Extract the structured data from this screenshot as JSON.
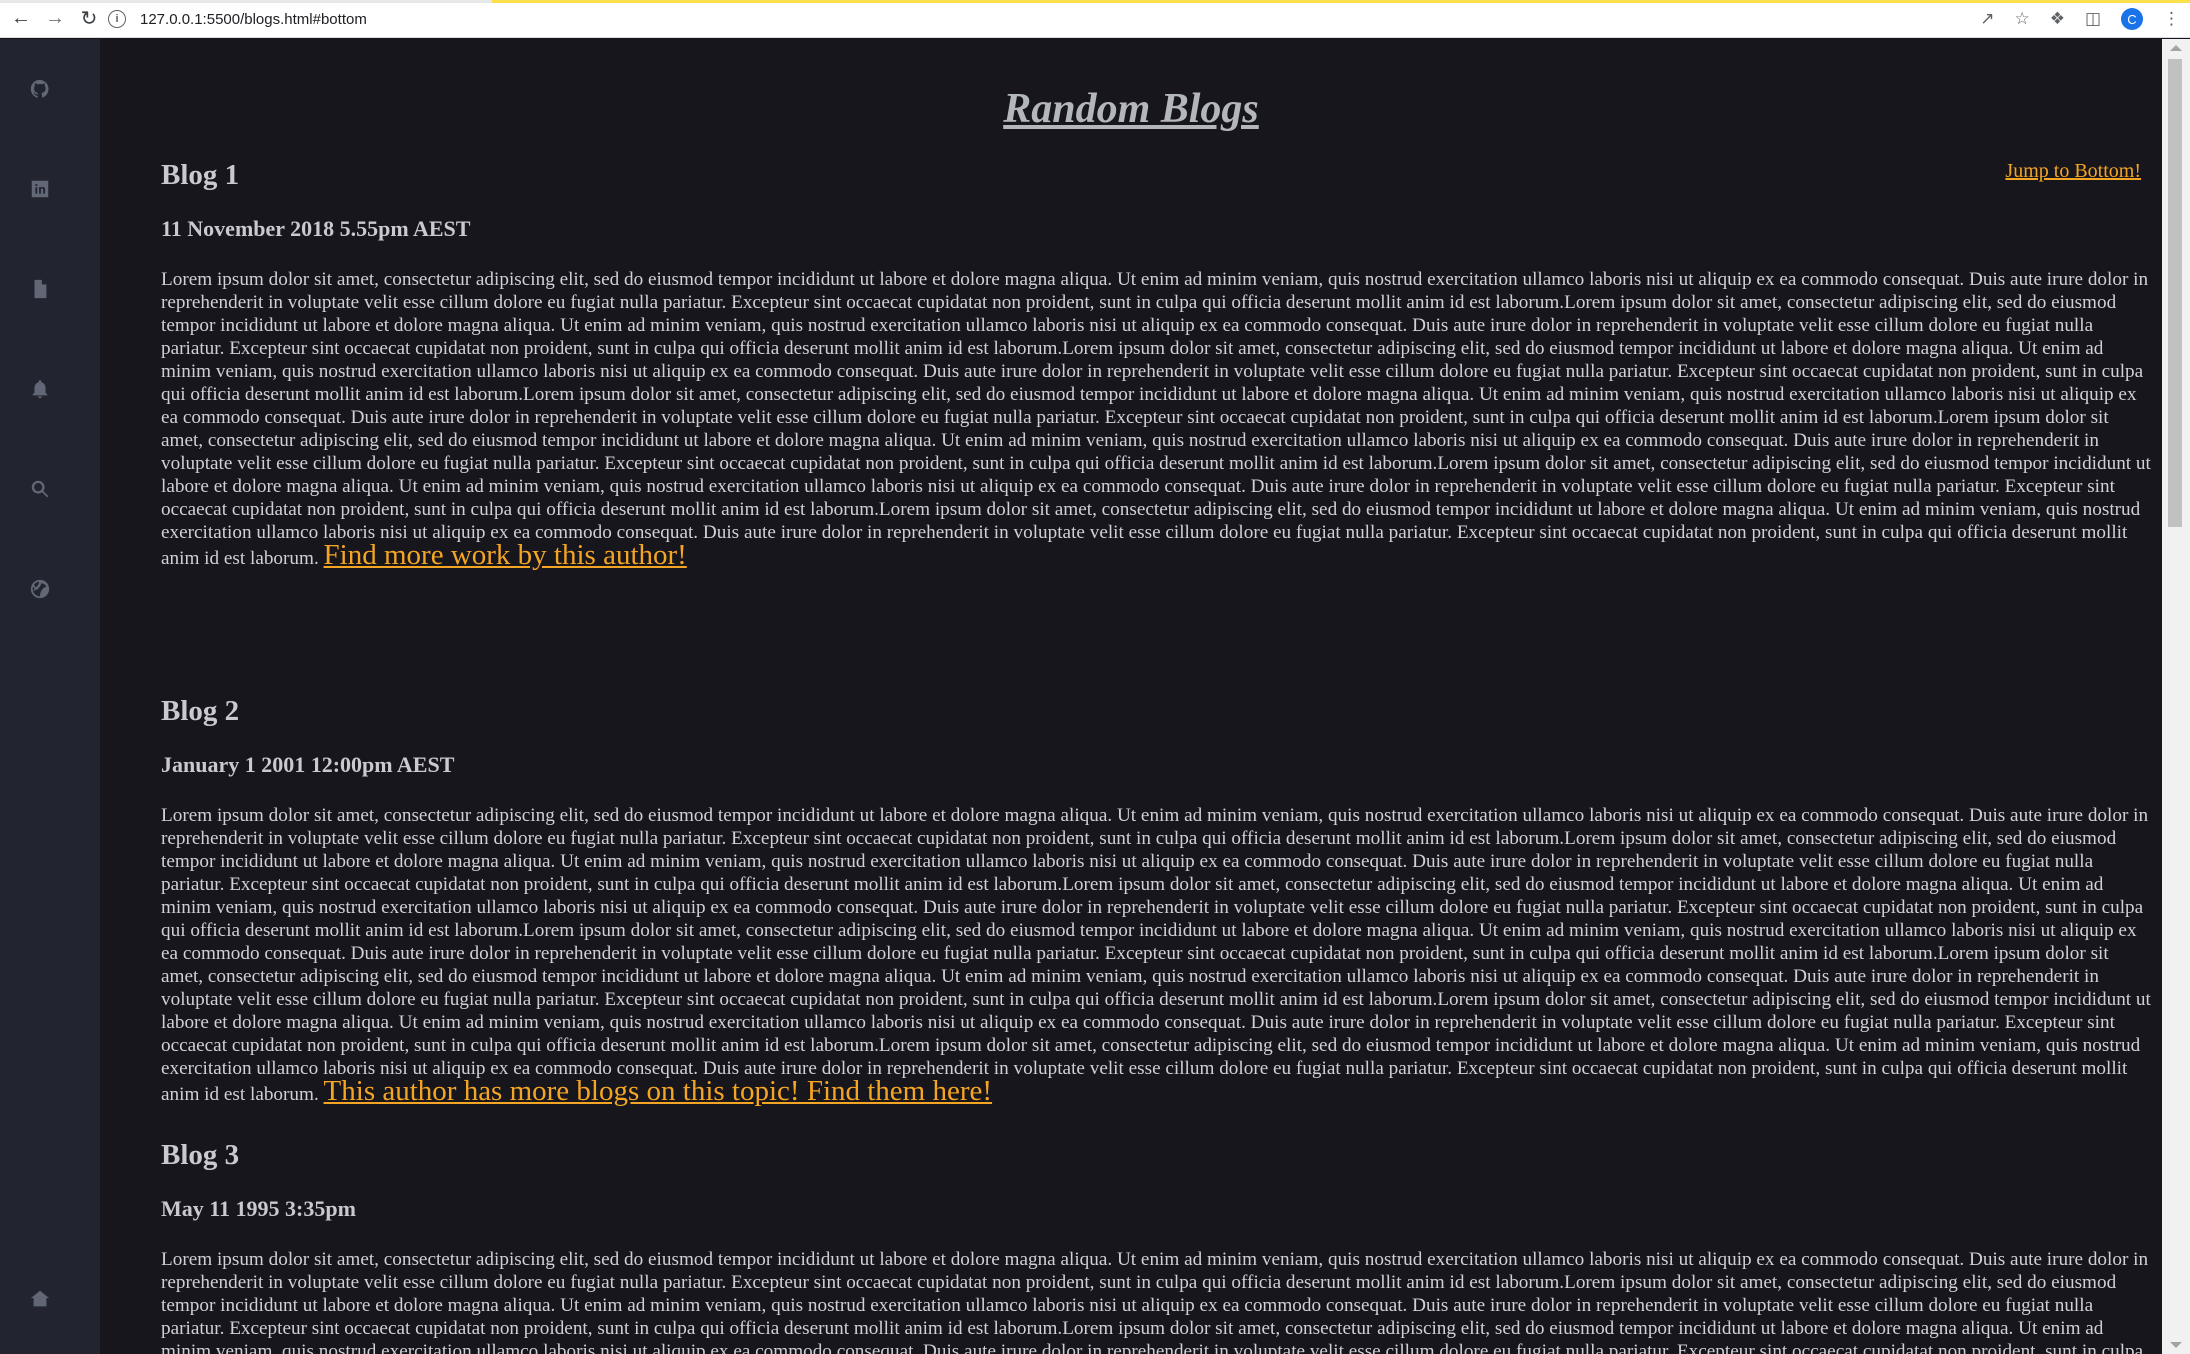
{
  "browser": {
    "url": "127.0.0.1:5500/blogs.html#bottom",
    "avatar_letter": "C"
  },
  "sidebar": {
    "items": [
      {
        "icon": "github-icon"
      },
      {
        "icon": "linkedin-icon"
      },
      {
        "icon": "document-icon"
      },
      {
        "icon": "bell-icon"
      },
      {
        "icon": "search-icon"
      },
      {
        "icon": "basketball-icon"
      },
      {
        "icon": "home-icon"
      }
    ]
  },
  "page": {
    "title": "Random Blogs",
    "jump_link": "Jump to Bottom!"
  },
  "blogs": [
    {
      "title": "Blog 1",
      "date": "11 November 2018 5.55pm AEST",
      "body": "Lorem ipsum dolor sit amet, consectetur adipiscing elit, sed do eiusmod tempor incididunt ut labore et dolore magna aliqua. Ut enim ad minim veniam, quis nostrud exercitation ullamco laboris nisi ut aliquip ex ea commodo consequat. Duis aute irure dolor in reprehenderit in voluptate velit esse cillum dolore eu fugiat nulla pariatur. Excepteur sint occaecat cupidatat non proident, sunt in culpa qui officia deserunt mollit anim id est laborum.Lorem ipsum dolor sit amet, consectetur adipiscing elit, sed do eiusmod tempor incididunt ut labore et dolore magna aliqua. Ut enim ad minim veniam, quis nostrud exercitation ullamco laboris nisi ut aliquip ex ea commodo consequat. Duis aute irure dolor in reprehenderit in voluptate velit esse cillum dolore eu fugiat nulla pariatur. Excepteur sint occaecat cupidatat non proident, sunt in culpa qui officia deserunt mollit anim id est laborum.Lorem ipsum dolor sit amet, consectetur adipiscing elit, sed do eiusmod tempor incididunt ut labore et dolore magna aliqua. Ut enim ad minim veniam, quis nostrud exercitation ullamco laboris nisi ut aliquip ex ea commodo consequat. Duis aute irure dolor in reprehenderit in voluptate velit esse cillum dolore eu fugiat nulla pariatur. Excepteur sint occaecat cupidatat non proident, sunt in culpa qui officia deserunt mollit anim id est laborum.Lorem ipsum dolor sit amet, consectetur adipiscing elit, sed do eiusmod tempor incididunt ut labore et dolore magna aliqua. Ut enim ad minim veniam, quis nostrud exercitation ullamco laboris nisi ut aliquip ex ea commodo consequat. Duis aute irure dolor in reprehenderit in voluptate velit esse cillum dolore eu fugiat nulla pariatur. Excepteur sint occaecat cupidatat non proident, sunt in culpa qui officia deserunt mollit anim id est laborum.Lorem ipsum dolor sit amet, consectetur adipiscing elit, sed do eiusmod tempor incididunt ut labore et dolore magna aliqua. Ut enim ad minim veniam, quis nostrud exercitation ullamco laboris nisi ut aliquip ex ea commodo consequat. Duis aute irure dolor in reprehenderit in voluptate velit esse cillum dolore eu fugiat nulla pariatur. Excepteur sint occaecat cupidatat non proident, sunt in culpa qui officia deserunt mollit anim id est laborum.Lorem ipsum dolor sit amet, consectetur adipiscing elit, sed do eiusmod tempor incididunt ut labore et dolore magna aliqua. Ut enim ad minim veniam, quis nostrud exercitation ullamco laboris nisi ut aliquip ex ea commodo consequat. Duis aute irure dolor in reprehenderit in voluptate velit esse cillum dolore eu fugiat nulla pariatur. Excepteur sint occaecat cupidatat non proident, sunt in culpa qui officia deserunt mollit anim id est laborum.Lorem ipsum dolor sit amet, consectetur adipiscing elit, sed do eiusmod tempor incididunt ut labore et dolore magna aliqua. Ut enim ad minim veniam, quis nostrud exercitation ullamco laboris nisi ut aliquip ex ea commodo consequat. Duis aute irure dolor in reprehenderit in voluptate velit esse cillum dolore eu fugiat nulla pariatur. Excepteur sint occaecat cupidatat non proident, sunt in culpa qui officia deserunt mollit anim id est laborum. ",
      "link": "Find more work by this author!"
    },
    {
      "title": "Blog 2",
      "date": "January 1 2001 12:00pm AEST",
      "body": "Lorem ipsum dolor sit amet, consectetur adipiscing elit, sed do eiusmod tempor incididunt ut labore et dolore magna aliqua. Ut enim ad minim veniam, quis nostrud exercitation ullamco laboris nisi ut aliquip ex ea commodo consequat. Duis aute irure dolor in reprehenderit in voluptate velit esse cillum dolore eu fugiat nulla pariatur. Excepteur sint occaecat cupidatat non proident, sunt in culpa qui officia deserunt mollit anim id est laborum.Lorem ipsum dolor sit amet, consectetur adipiscing elit, sed do eiusmod tempor incididunt ut labore et dolore magna aliqua. Ut enim ad minim veniam, quis nostrud exercitation ullamco laboris nisi ut aliquip ex ea commodo consequat. Duis aute irure dolor in reprehenderit in voluptate velit esse cillum dolore eu fugiat nulla pariatur. Excepteur sint occaecat cupidatat non proident, sunt in culpa qui officia deserunt mollit anim id est laborum.Lorem ipsum dolor sit amet, consectetur adipiscing elit, sed do eiusmod tempor incididunt ut labore et dolore magna aliqua. Ut enim ad minim veniam, quis nostrud exercitation ullamco laboris nisi ut aliquip ex ea commodo consequat. Duis aute irure dolor in reprehenderit in voluptate velit esse cillum dolore eu fugiat nulla pariatur. Excepteur sint occaecat cupidatat non proident, sunt in culpa qui officia deserunt mollit anim id est laborum.Lorem ipsum dolor sit amet, consectetur adipiscing elit, sed do eiusmod tempor incididunt ut labore et dolore magna aliqua. Ut enim ad minim veniam, quis nostrud exercitation ullamco laboris nisi ut aliquip ex ea commodo consequat. Duis aute irure dolor in reprehenderit in voluptate velit esse cillum dolore eu fugiat nulla pariatur. Excepteur sint occaecat cupidatat non proident, sunt in culpa qui officia deserunt mollit anim id est laborum.Lorem ipsum dolor sit amet, consectetur adipiscing elit, sed do eiusmod tempor incididunt ut labore et dolore magna aliqua. Ut enim ad minim veniam, quis nostrud exercitation ullamco laboris nisi ut aliquip ex ea commodo consequat. Duis aute irure dolor in reprehenderit in voluptate velit esse cillum dolore eu fugiat nulla pariatur. Excepteur sint occaecat cupidatat non proident, sunt in culpa qui officia deserunt mollit anim id est laborum.Lorem ipsum dolor sit amet, consectetur adipiscing elit, sed do eiusmod tempor incididunt ut labore et dolore magna aliqua. Ut enim ad minim veniam, quis nostrud exercitation ullamco laboris nisi ut aliquip ex ea commodo consequat. Duis aute irure dolor in reprehenderit in voluptate velit esse cillum dolore eu fugiat nulla pariatur. Excepteur sint occaecat cupidatat non proident, sunt in culpa qui officia deserunt mollit anim id est laborum.Lorem ipsum dolor sit amet, consectetur adipiscing elit, sed do eiusmod tempor incididunt ut labore et dolore magna aliqua. Ut enim ad minim veniam, quis nostrud exercitation ullamco laboris nisi ut aliquip ex ea commodo consequat. Duis aute irure dolor in reprehenderit in voluptate velit esse cillum dolore eu fugiat nulla pariatur. Excepteur sint occaecat cupidatat non proident, sunt in culpa qui officia deserunt mollit anim id est laborum. ",
      "link": "This author has more blogs on this topic! Find them here!"
    },
    {
      "title": "Blog 3",
      "date": "May 11 1995 3:35pm",
      "body": "Lorem ipsum dolor sit amet, consectetur adipiscing elit, sed do eiusmod tempor incididunt ut labore et dolore magna aliqua. Ut enim ad minim veniam, quis nostrud exercitation ullamco laboris nisi ut aliquip ex ea commodo consequat. Duis aute irure dolor in reprehenderit in voluptate velit esse cillum dolore eu fugiat nulla pariatur. Excepteur sint occaecat cupidatat non proident, sunt in culpa qui officia deserunt mollit anim id est laborum.Lorem ipsum dolor sit amet, consectetur adipiscing elit, sed do eiusmod tempor incididunt ut labore et dolore magna aliqua. Ut enim ad minim veniam, quis nostrud exercitation ullamco laboris nisi ut aliquip ex ea commodo consequat. Duis aute irure dolor in reprehenderit in voluptate velit esse cillum dolore eu fugiat nulla pariatur. Excepteur sint occaecat cupidatat non proident, sunt in culpa qui officia deserunt mollit anim id est laborum.Lorem ipsum dolor sit amet, consectetur adipiscing elit, sed do eiusmod tempor incididunt ut labore et dolore magna aliqua. Ut enim ad minim veniam, quis nostrud exercitation ullamco laboris nisi ut aliquip ex ea commodo consequat. Duis aute irure dolor in reprehenderit in voluptate velit esse cillum dolore eu fugiat nulla pariatur. Excepteur sint occaecat cupidatat non proident, sunt in culpa qui officia deserunt mollit anim id est laborum.Lorem ipsum dolor sit amet, consectetur adipiscing elit, sed do eiusmod tempor incididunt ut labore et dolore magna aliqua. Ut enim ad minim veniam, quis nostrud exercitation ullamco laboris nisi ut aliquip ex ea commodo consequat. Duis aute irure dolor in reprehenderit in voluptate velit esse cillum dolore eu fugiat nulla pariatur."
    }
  ],
  "colors": {
    "background": "#16161c",
    "sidebar": "#22252f",
    "text": "#d0d0d6",
    "link": "#f5a524",
    "title": "#b4b6be"
  }
}
